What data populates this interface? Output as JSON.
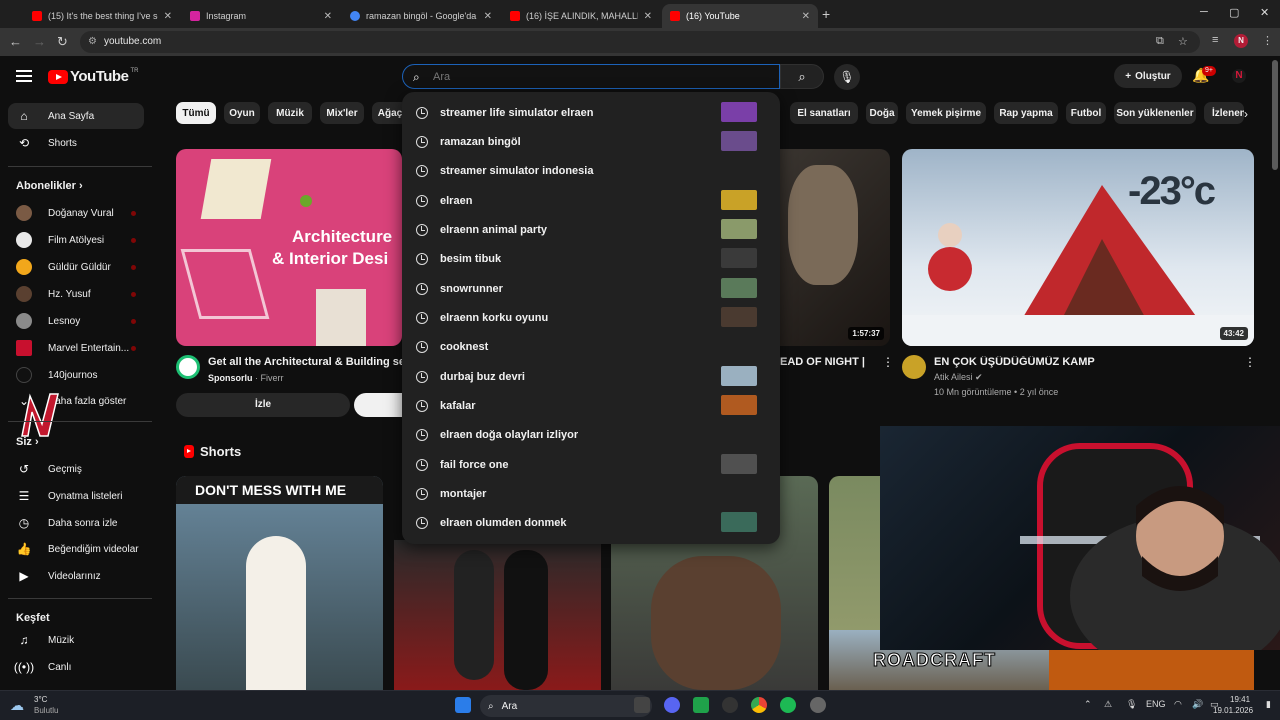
{
  "browser": {
    "tabs": [
      {
        "title": "(15) It's the best thing I've seen",
        "fav": "#ff0000"
      },
      {
        "title": "Instagram",
        "fav": "#d6249f"
      },
      {
        "title": "ramazan bingöl - Google'da Ara",
        "fav": "#4285f4"
      },
      {
        "title": "(16) İŞE ALINDIK, MAHALLEYE",
        "fav": "#ff0000"
      },
      {
        "title": "(16) YouTube",
        "fav": "#ff0000"
      }
    ],
    "url": "youtube.com"
  },
  "header": {
    "logo": "YouTube",
    "country": "TR",
    "search_placeholder": "Ara",
    "create_label": "Oluştur",
    "notif_badge": "9+",
    "avatar_letter": "N"
  },
  "sidebar": {
    "home": "Ana Sayfa",
    "shorts": "Shorts",
    "subs_title": "Abonelikler",
    "subs": [
      {
        "name": "Doğanay Vural",
        "color": "#7a5a44"
      },
      {
        "name": "Film Atölyesi",
        "color": "#e8e8e8"
      },
      {
        "name": "Güldür Güldür",
        "color": "#f2a71b"
      },
      {
        "name": "Hz. Yusuf",
        "color": "#5a4030"
      },
      {
        "name": "Lesnoy",
        "color": "#8a8a8a"
      },
      {
        "name": "Marvel Entertain...",
        "color": "#c8102e"
      },
      {
        "name": "140journos",
        "color": "#111111"
      }
    ],
    "show_more": "Daha fazla göster",
    "you_title": "Siz",
    "you": [
      {
        "label": "Geçmiş",
        "icon": "history-icon"
      },
      {
        "label": "Oynatma listeleri",
        "icon": "playlist-icon"
      },
      {
        "label": "Daha sonra izle",
        "icon": "watch-later-icon"
      },
      {
        "label": "Beğendiğim videolar",
        "icon": "like-icon"
      },
      {
        "label": "Videolarınız",
        "icon": "your-videos-icon"
      }
    ],
    "explore_title": "Keşfet",
    "explore": [
      {
        "label": "Müzik",
        "icon": "music-icon"
      },
      {
        "label": "Canlı",
        "icon": "live-icon"
      }
    ]
  },
  "chips": [
    "Tümü",
    "Oyun",
    "Müzik",
    "Mix'ler",
    "Ağaç",
    "El sanatları",
    "Doğa",
    "Yemek pişirme",
    "Rap yapma",
    "Futbol",
    "Son yüklenenler",
    "İzlenen"
  ],
  "videos": {
    "ad": {
      "title": "Get all the Architectural & Building servic",
      "sponsor": "Sponsorlu",
      "advertiser": "Fiverr",
      "thumb_text_1": "Architecture",
      "thumb_text_2": "& Interior Desi",
      "cta": "İzle"
    },
    "middle": {
      "title_partial": "EAD OF NIGHT |",
      "duration": "1:57:37"
    },
    "camp": {
      "title": "EN ÇOK ÜŞÜDÜĞÜMÜZ KAMP",
      "channel": "Atik Ailesi",
      "meta": "10 Mn görüntüleme • 2 yıl önce",
      "duration": "43:42",
      "thumb_text": "-23°c"
    }
  },
  "shorts": {
    "title": "Shorts",
    "first_text": "DON'T MESS WITH ME",
    "roadcraft": "ROADCRAFT"
  },
  "suggestions": [
    {
      "text": "streamer life simulator elraen",
      "thumb": "#7a3fa8"
    },
    {
      "text": "ramazan bingöl",
      "thumb": "#6a4c8c"
    },
    {
      "text": "streamer simulator indonesia",
      "thumb": null
    },
    {
      "text": "elraen",
      "thumb": "#c9a227"
    },
    {
      "text": "elraenn animal party",
      "thumb": "#8a9a6a"
    },
    {
      "text": "besim tibuk",
      "thumb": "#3a3a3a"
    },
    {
      "text": "snowrunner",
      "thumb": "#5a7a5a"
    },
    {
      "text": "elraenn korku oyunu",
      "thumb": "#4a3a30"
    },
    {
      "text": "cooknest",
      "thumb": null
    },
    {
      "text": "durbaj buz devri",
      "thumb": "#9ab0c0"
    },
    {
      "text": "kafalar",
      "thumb": "#b05a20"
    },
    {
      "text": "elraen doğa olayları izliyor",
      "thumb": null
    },
    {
      "text": "fail force one",
      "thumb": "#505050"
    },
    {
      "text": "montajer",
      "thumb": null
    },
    {
      "text": "elraen olumden donmek",
      "thumb": "#3a6a5a"
    }
  ],
  "taskbar": {
    "weather_temp": "3°C",
    "weather_desc": "Bulutlu",
    "search": "Ara",
    "lang": "ENG",
    "time": "19:41",
    "date": "19.01.2026"
  }
}
